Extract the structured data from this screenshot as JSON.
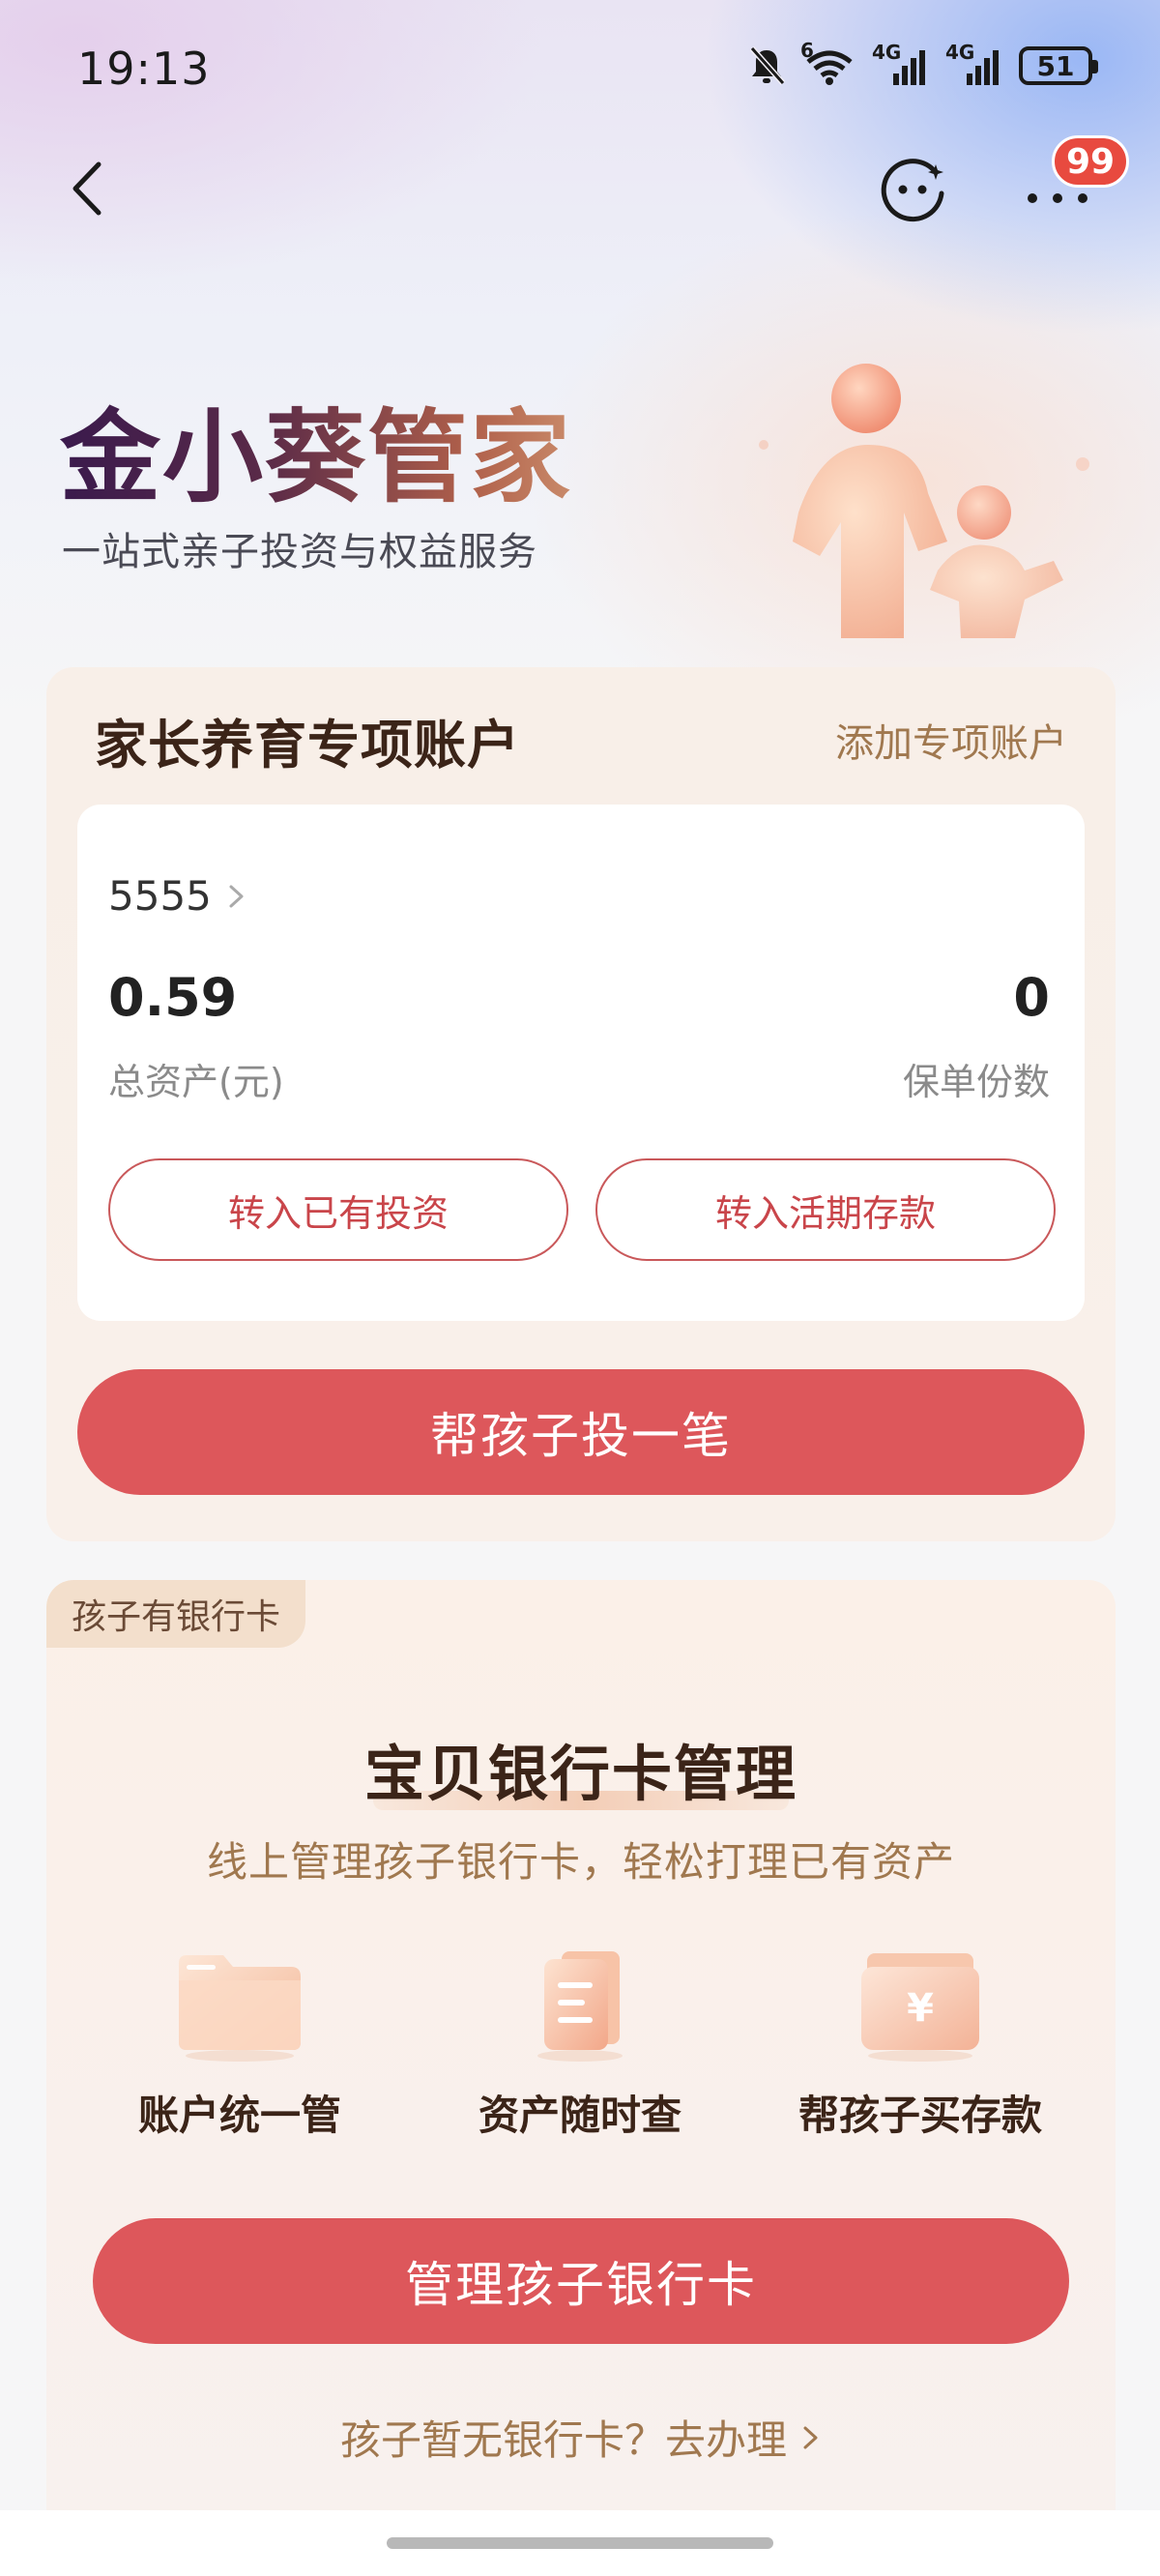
{
  "status_bar": {
    "time": "19:13",
    "battery": "51",
    "network_1": "4G",
    "network_2": "4G",
    "wifi_badge": "6"
  },
  "nav": {
    "badge_count": "99"
  },
  "hero": {
    "title": "金小葵管家",
    "subtitle": "一站式亲子投资与权益服务"
  },
  "account_card": {
    "title": "家长养育专项账户",
    "add_link": "添加专项账户",
    "account_name": "5555",
    "total_assets_value": "0.59",
    "total_assets_label": "总资产(元)",
    "policy_count_value": "0",
    "policy_count_label": "保单份数",
    "transfer_invest_button": "转入已有投资",
    "transfer_deposit_button": "转入活期存款",
    "invest_button": "帮孩子投一笔"
  },
  "bank_card": {
    "tag": "孩子有银行卡",
    "title": "宝贝银行卡管理",
    "subtitle": "线上管理孩子银行卡，轻松打理已有资产",
    "features": [
      {
        "label": "账户统一管",
        "icon": "folder-icon"
      },
      {
        "label": "资产随时查",
        "icon": "clipboard-icon"
      },
      {
        "label": "帮孩子买存款",
        "icon": "yuan-wallet-icon"
      }
    ],
    "manage_button": "管理孩子银行卡",
    "apply_link": "孩子暂无银行卡？去办理"
  },
  "colors": {
    "primary_red": "#dd575b",
    "gold_text": "#a0784f",
    "badge_red": "#e84a3f"
  }
}
